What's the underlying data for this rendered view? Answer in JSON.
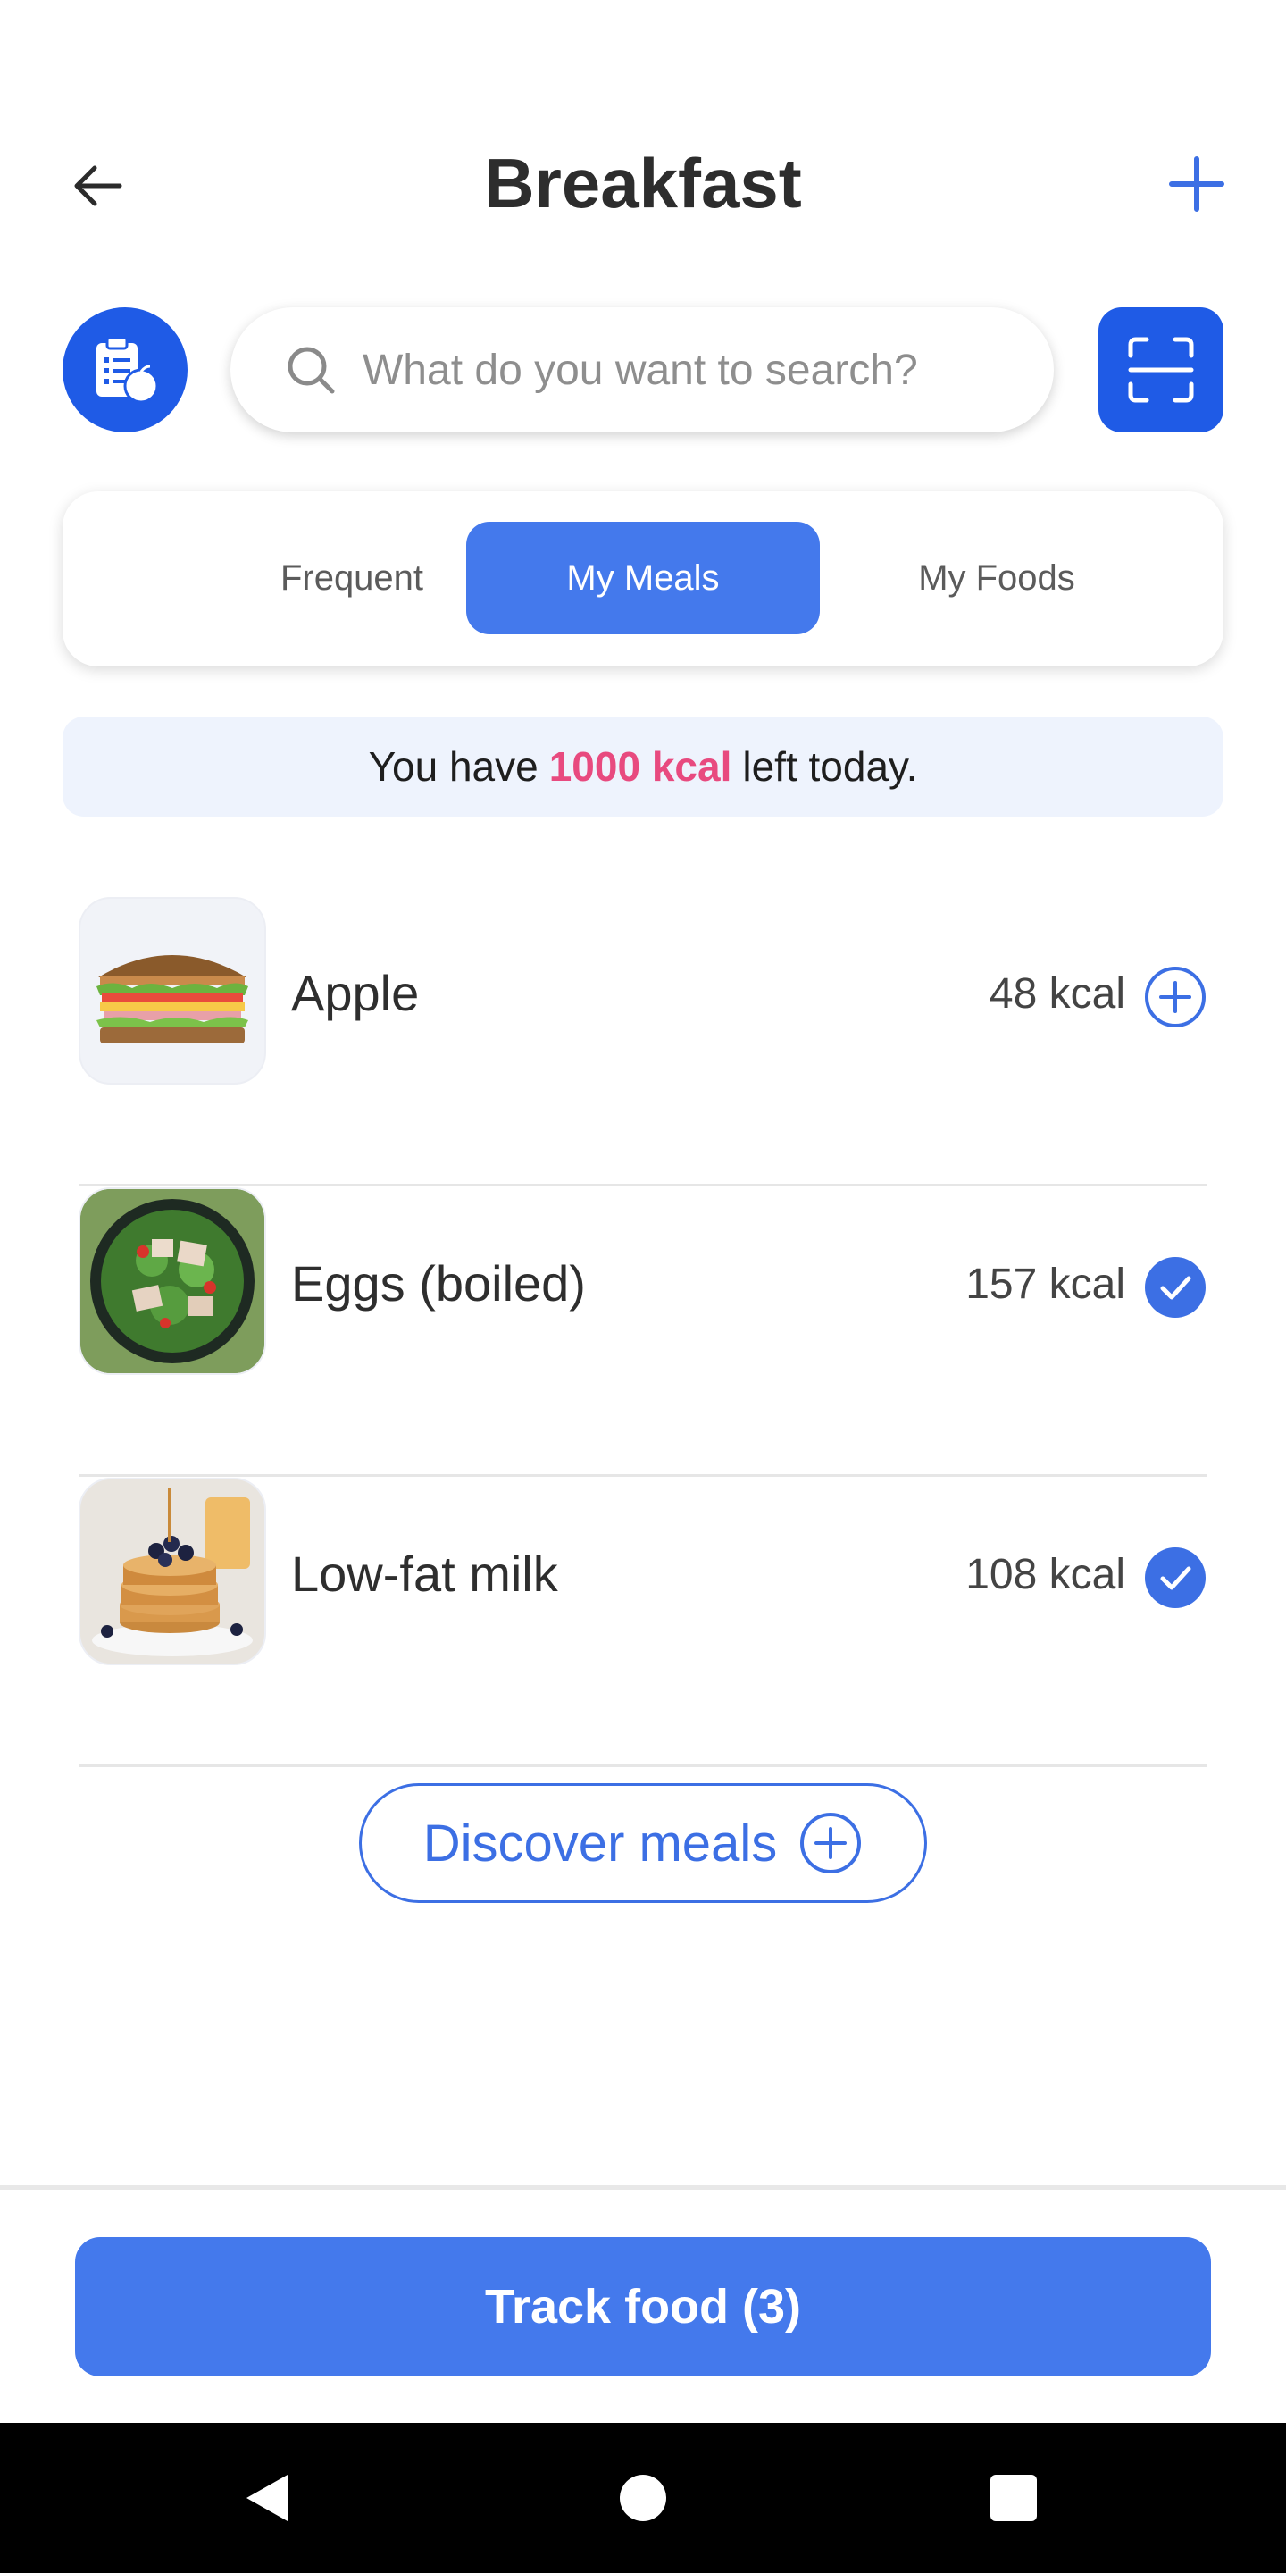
{
  "header": {
    "title": "Breakfast",
    "back_icon": "arrow-left-icon",
    "add_icon": "plus-icon"
  },
  "search": {
    "placeholder": "What do you want to search?",
    "value": ""
  },
  "tabs": [
    {
      "label": "Frequent",
      "active": false
    },
    {
      "label": "My Meals",
      "active": true
    },
    {
      "label": "My Foods",
      "active": false
    }
  ],
  "banner": {
    "prefix": "You have",
    "highlight": "1000 kcal",
    "suffix": "left today."
  },
  "items": [
    {
      "name": "Apple",
      "kcal": "48 kcal",
      "selected": false,
      "image_icon": "sandwich-image"
    },
    {
      "name": "Eggs (boiled)",
      "kcal": "157 kcal",
      "selected": true,
      "image_icon": "salad-image"
    },
    {
      "name": "Low-fat milk",
      "kcal": "108 kcal",
      "selected": true,
      "image_icon": "pancakes-image"
    }
  ],
  "discover": {
    "label": "Discover meals"
  },
  "track": {
    "label": "Track food (3)"
  },
  "colors": {
    "primary": "#1f5be6",
    "accent": "#4479ec",
    "highlight": "#e84a7f",
    "banner_bg": "#eef3fd"
  }
}
